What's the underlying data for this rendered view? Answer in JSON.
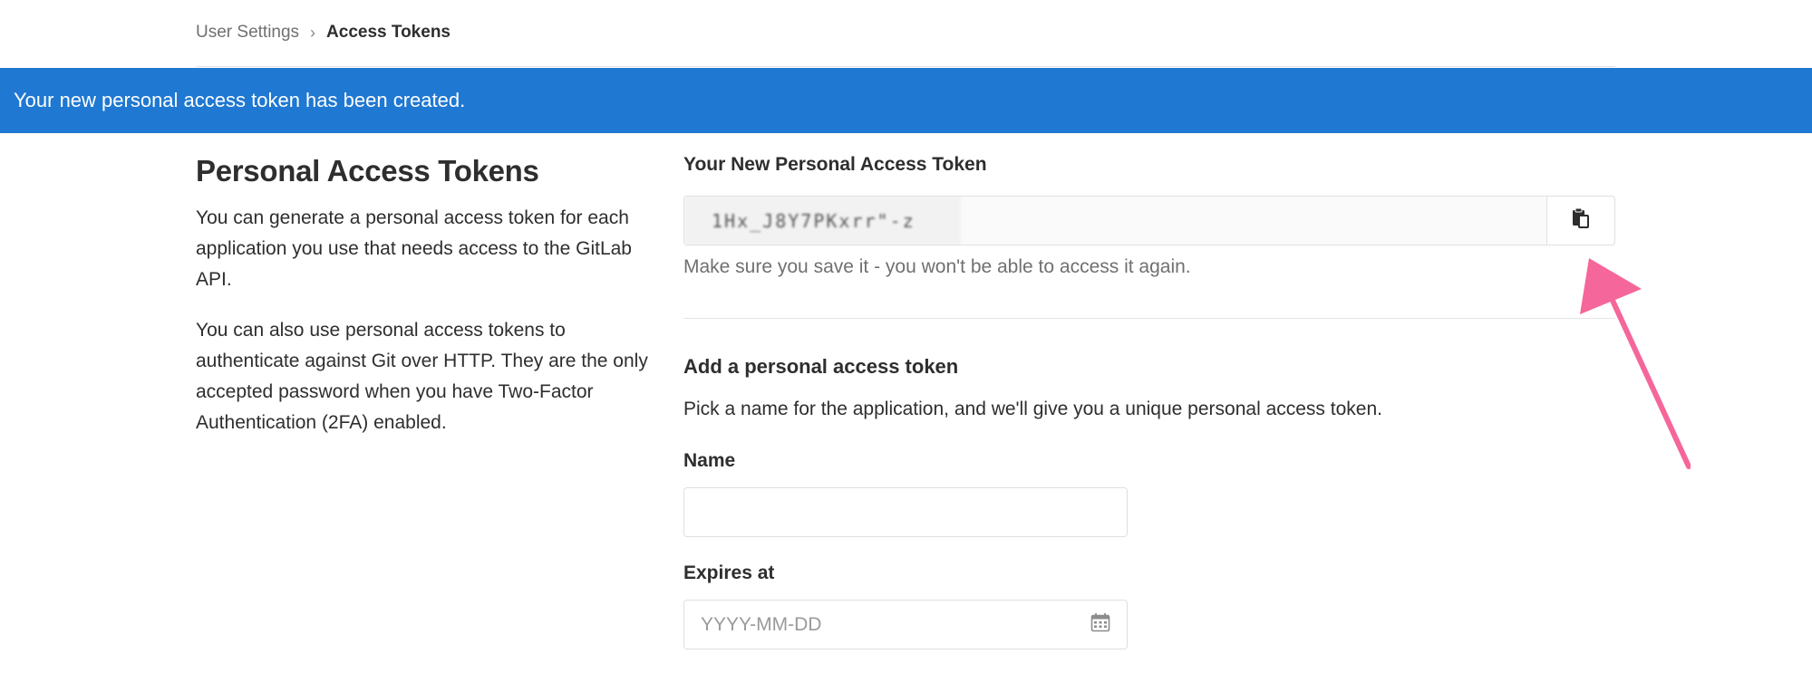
{
  "breadcrumb": {
    "parent": "User Settings",
    "separator": "›",
    "current": "Access Tokens"
  },
  "flash": {
    "message": "Your new personal access token has been created.",
    "color": "#1f78d1"
  },
  "left": {
    "title": "Personal Access Tokens",
    "paragraph1": "You can generate a personal access token for each application you use that needs access to the GitLab API.",
    "paragraph2": "You can also use personal access tokens to authenticate against Git over HTTP. They are the only accepted password when you have Two-Factor Authentication (2FA) enabled."
  },
  "new_token": {
    "label": "Your New Personal Access Token",
    "value": "1Hx_J8Y7PKxrr\"-z",
    "copy_icon": "clipboard-icon",
    "help": "Make sure you save it - you won't be able to access it again."
  },
  "add_token": {
    "title": "Add a personal access token",
    "description": "Pick a name for the application, and we'll give you a unique personal access token.",
    "name_label": "Name",
    "name_value": "",
    "expires_label": "Expires at",
    "expires_placeholder": "YYYY-MM-DD",
    "calendar_icon": "calendar-icon"
  },
  "annotation": {
    "arrow_color": "#f5669a"
  }
}
